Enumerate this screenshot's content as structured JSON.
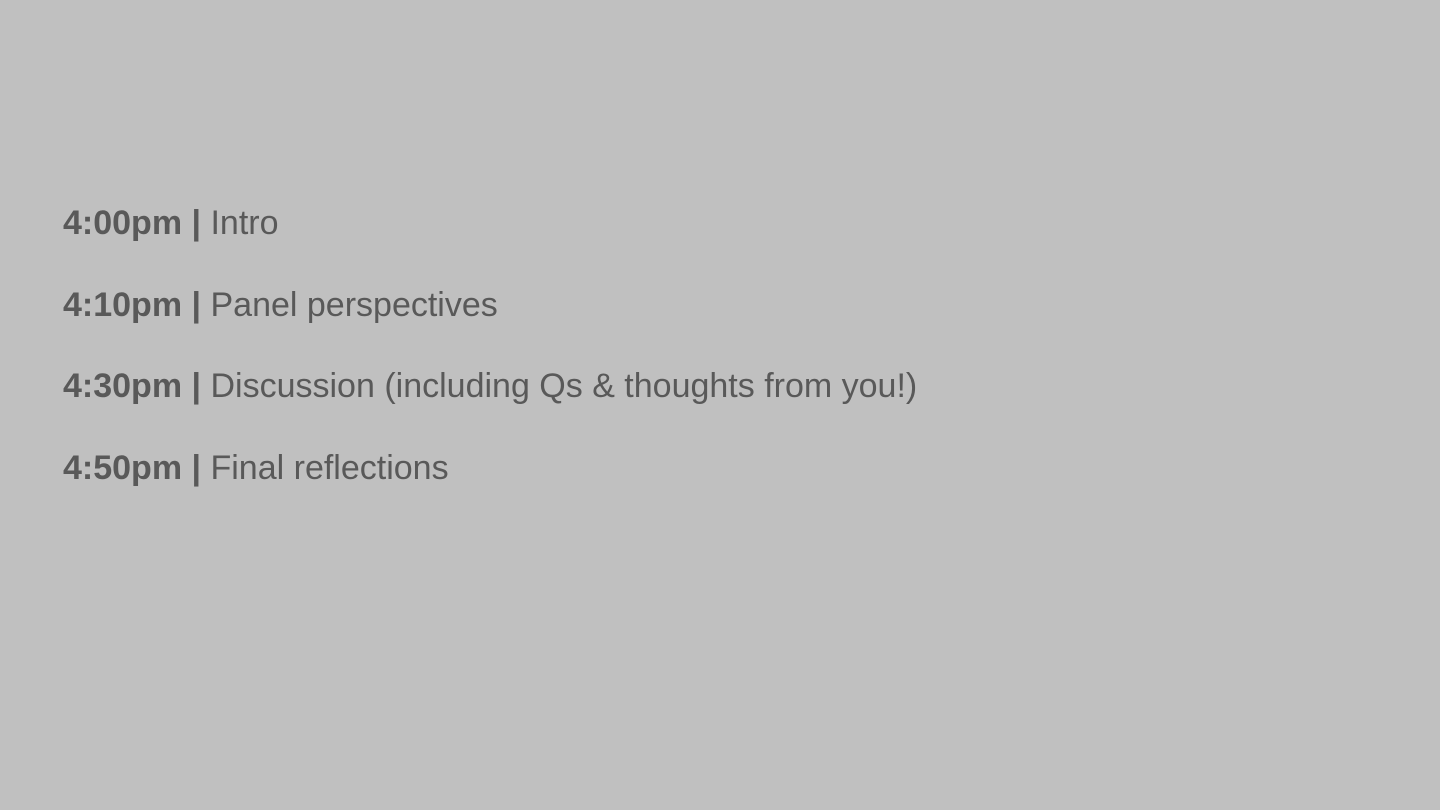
{
  "colors": {
    "background": "#c0c0c0",
    "text": "#595959"
  },
  "agenda": {
    "separator": "|",
    "items": [
      {
        "time": "4:00pm",
        "title": "Intro"
      },
      {
        "time": "4:10pm",
        "title": "Panel perspectives"
      },
      {
        "time": "4:30pm",
        "title": "Discussion (including Qs & thoughts from you!)"
      },
      {
        "time": "4:50pm",
        "title": "Final reflections"
      }
    ]
  }
}
